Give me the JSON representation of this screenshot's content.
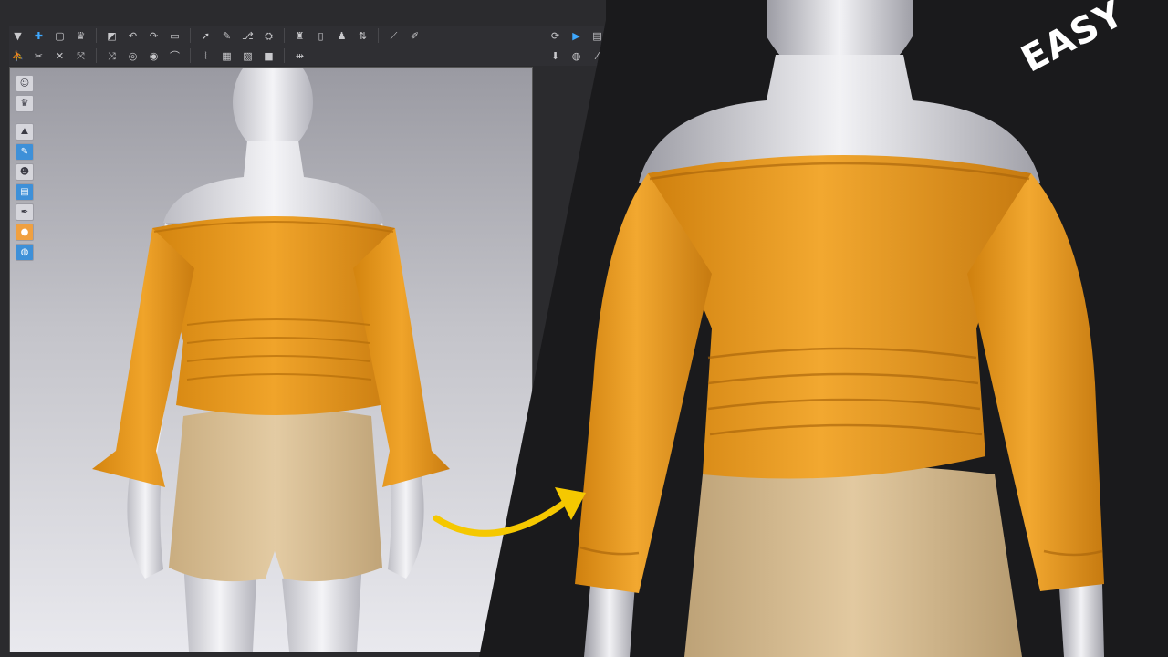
{
  "badge": {
    "text": "EASY"
  },
  "colors": {
    "blouse": "#e89a22",
    "blouse_shade": "#c77c12",
    "shorts": "#dcc39a",
    "skirt": "#d8c098",
    "avatar": "#e8e8ec",
    "arrow": "#f5c800",
    "toolbar_bg": "#2f2f33",
    "accent": "#3ea8ff"
  },
  "toolbar_top": {
    "buttons": [
      {
        "name": "arrow-down-icon",
        "glyph": "▼"
      },
      {
        "name": "add-point-icon",
        "glyph": "✚",
        "accent": true
      },
      {
        "name": "select-box-icon",
        "glyph": "▢"
      },
      {
        "name": "garment-icon",
        "glyph": "♛"
      },
      {
        "name": "segment-icon",
        "glyph": "◩"
      },
      {
        "name": "curve-icon",
        "glyph": "↶"
      },
      {
        "name": "curve-alt-icon",
        "glyph": "↷"
      },
      {
        "name": "tape-icon",
        "glyph": "▭"
      },
      {
        "name": "needle-icon",
        "glyph": "➚"
      },
      {
        "name": "pin-icon",
        "glyph": "✎"
      },
      {
        "name": "fold-icon",
        "glyph": "⎇"
      },
      {
        "name": "shirt-icon",
        "glyph": "⛭"
      },
      {
        "name": "tshirt-icon",
        "glyph": "♜"
      },
      {
        "name": "book-icon",
        "glyph": "▯"
      },
      {
        "name": "person-icon",
        "glyph": "♟"
      },
      {
        "name": "measure-icon",
        "glyph": "⇅"
      },
      {
        "name": "ruler-icon",
        "glyph": "⟋"
      },
      {
        "name": "pencil-icon",
        "glyph": "✐"
      }
    ],
    "right_buttons": [
      {
        "name": "sync-icon",
        "glyph": "⟳"
      },
      {
        "name": "record-icon",
        "glyph": "▶",
        "accent": true
      },
      {
        "name": "film-icon",
        "glyph": "▤"
      }
    ]
  },
  "toolbar_second": {
    "buttons": [
      {
        "name": "walk-icon",
        "glyph": "⛹"
      },
      {
        "name": "scissors-icon",
        "glyph": "✂"
      },
      {
        "name": "cross-icon",
        "glyph": "✕"
      },
      {
        "name": "transform-icon",
        "glyph": "⤧"
      },
      {
        "name": "split-icon",
        "glyph": "⤨"
      },
      {
        "name": "button-tool-icon",
        "glyph": "◎"
      },
      {
        "name": "buttonhole-icon",
        "glyph": "◉"
      },
      {
        "name": "hanger-icon",
        "glyph": "⌒"
      },
      {
        "name": "zipper-icon",
        "glyph": "⦚"
      },
      {
        "name": "texture-icon",
        "glyph": "▦"
      },
      {
        "name": "shade-icon",
        "glyph": "▧"
      },
      {
        "name": "fill-icon",
        "glyph": "■"
      },
      {
        "name": "align-icon",
        "glyph": "⇹"
      }
    ],
    "right_buttons": [
      {
        "name": "download-icon",
        "glyph": "⬇"
      },
      {
        "name": "globe-icon",
        "glyph": "◍"
      },
      {
        "name": "slash-icon",
        "glyph": "⁄"
      }
    ]
  },
  "side_tools": [
    {
      "name": "avatar-tool-icon",
      "glyph": "☺",
      "style": ""
    },
    {
      "name": "garment-tool-icon",
      "glyph": "♛",
      "style": ""
    },
    {
      "name": "gap",
      "glyph": "",
      "style": "gap"
    },
    {
      "name": "scene-tool-icon",
      "glyph": "⛰",
      "style": ""
    },
    {
      "name": "brush-tool-icon",
      "glyph": "✎",
      "style": "blue"
    },
    {
      "name": "figure-tool-icon",
      "glyph": "☻",
      "style": ""
    },
    {
      "name": "layer-tool-icon",
      "glyph": "▤",
      "style": "blue"
    },
    {
      "name": "pen-tool-icon",
      "glyph": "✒",
      "style": ""
    },
    {
      "name": "skin-tool-icon",
      "glyph": "●",
      "style": "orange"
    },
    {
      "name": "globe-tool-icon",
      "glyph": "◍",
      "style": "blue"
    }
  ]
}
